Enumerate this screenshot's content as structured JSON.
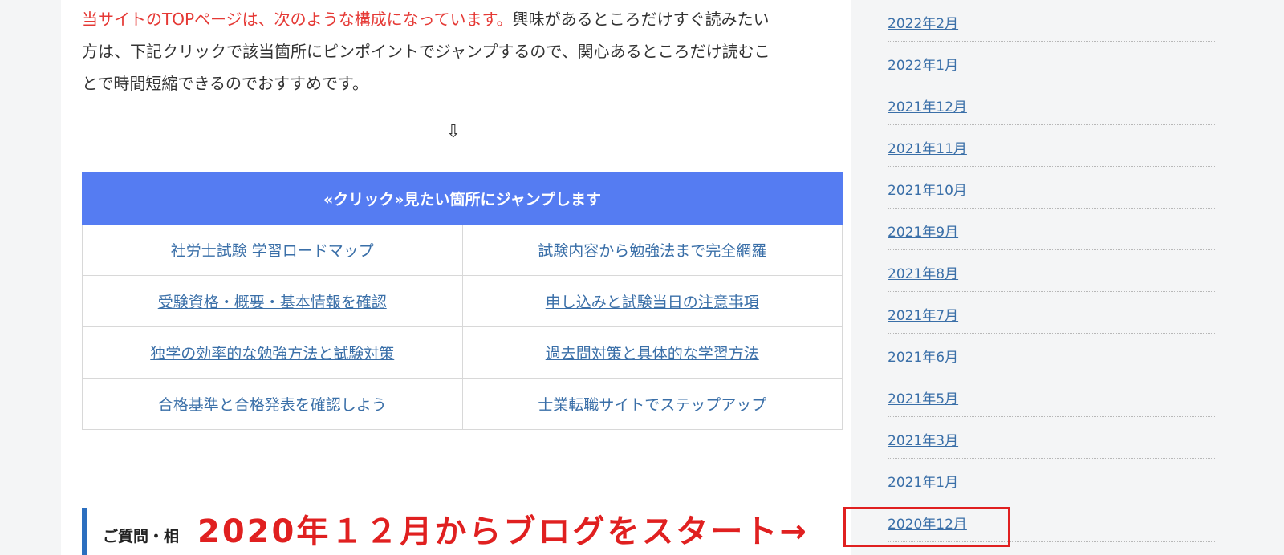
{
  "intro": {
    "red_text": "当サイトのTOPページは、次のような構成になっています。",
    "line1_rest": "興味があるところだけすぐ読みたい",
    "line2": "方は、下記クリックで該当箇所にピンポイントでジャンプするので、関心あるところだけ読むこ",
    "line3": "とで時間短縮できるのでおすすめです。"
  },
  "arrow_symbol": "⇩",
  "toc": {
    "header": "«クリック»見たい箇所にジャンプします",
    "rows": [
      [
        "社労士試験 学習ロードマップ",
        "試験内容から勉強法まで完全網羅"
      ],
      [
        "受験資格・概要・基本情報を確認",
        "申し込みと試験当日の注意事項"
      ],
      [
        "独学の効率的な勉強方法と試験対策",
        "過去問対策と具体的な学習方法"
      ],
      [
        "合格基準と合格発表を確認しよう",
        "士業転職サイトでステップアップ"
      ]
    ]
  },
  "section_heading": "ご質問・相",
  "archives": [
    "2022年2月",
    "2022年1月",
    "2021年12月",
    "2021年11月",
    "2021年10月",
    "2021年9月",
    "2021年8月",
    "2021年7月",
    "2021年6月",
    "2021年5月",
    "2021年3月",
    "2021年1月",
    "2020年12月"
  ],
  "annotation": {
    "text": "2020年１２月からブログをスタート→",
    "color": "#e02020"
  },
  "colors": {
    "toc_header_bg": "#557cf2",
    "link": "#3a6fa8",
    "heading_bar": "#2c6fbf"
  }
}
